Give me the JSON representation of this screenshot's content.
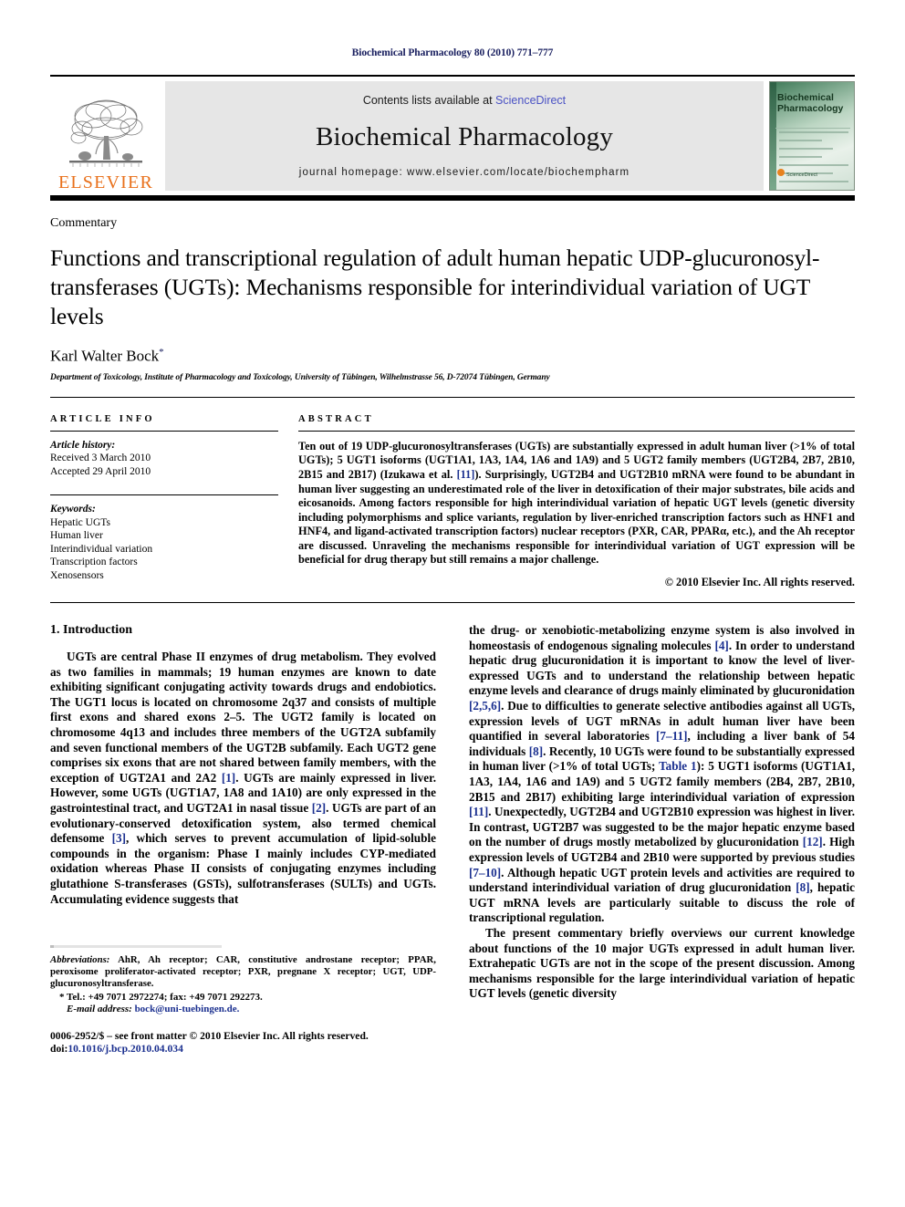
{
  "running_head": "Biochemical Pharmacology 80 (2010) 771–777",
  "masthead": {
    "publisher_word": "ELSEVIER",
    "contents_prefix": "Contents lists available at ",
    "contents_link": "ScienceDirect",
    "journal_name": "Biochemical Pharmacology",
    "homepage": "journal homepage: www.elsevier.com/locate/biochempharm",
    "cover_title_line1": "Biochemical",
    "cover_title_line2": "Pharmacology",
    "cover_footer": "ScienceDirect"
  },
  "article": {
    "type": "Commentary",
    "title": "Functions and transcriptional regulation of adult human hepatic UDP-glucuronosyl-transferases (UGTs): Mechanisms responsible for interindividual variation of UGT levels",
    "author": "Karl Walter Bock",
    "author_marker": "*",
    "affiliation": "Department of Toxicology, Institute of Pharmacology and Toxicology, University of Tübingen, Wilhelmstrasse 56, D-72074 Tübingen, Germany"
  },
  "info": {
    "heading": "ARTICLE INFO",
    "history_label": "Article history:",
    "history": [
      "Received 3 March 2010",
      "Accepted 29 April 2010"
    ],
    "keywords_label": "Keywords:",
    "keywords": [
      "Hepatic UGTs",
      "Human liver",
      "Interindividual variation",
      "Transcription factors",
      "Xenosensors"
    ]
  },
  "abstract": {
    "heading": "ABSTRACT",
    "part1": "Ten out of 19 UDP-glucuronosyltransferases (UGTs) are substantially expressed in adult human liver (>1% of total UGTs); 5 UGT1 isoforms (UGT1A1, 1A3, 1A4, 1A6 and 1A9) and 5 UGT2 family members (UGT2B4, 2B7, 2B10, 2B15 and 2B17) (Izukawa et al. ",
    "ref1": "[11]",
    "part2": "). Surprisingly, UGT2B4 and UGT2B10 mRNA were found to be abundant in human liver suggesting an underestimated role of the liver in detoxification of their major substrates, bile acids and eicosanoids. Among factors responsible for high interindividual variation of hepatic UGT levels (genetic diversity including polymorphisms and splice variants, regulation by liver-enriched transcription factors such as HNF1 and HNF4, and ligand-activated transcription factors) nuclear receptors (PXR, CAR, PPARα, etc.), and the Ah receptor are discussed. Unraveling the mechanisms responsible for interindividual variation of UGT expression will be beneficial for drug therapy but still remains a major challenge.",
    "copyright": "© 2010 Elsevier Inc. All rights reserved."
  },
  "body": {
    "section_title": "1. Introduction",
    "left_p1_a": "UGTs are central Phase II enzymes of drug metabolism. They evolved as two families in mammals; 19 human enzymes are known to date exhibiting significant conjugating activity towards drugs and endobiotics. The UGT1 locus is located on chromosome 2q37 and consists of multiple first exons and shared exons 2–5. The UGT2 family is located on chromosome 4q13 and includes three members of the UGT2A subfamily and seven functional members of the UGT2B subfamily. Each UGT2 gene comprises six exons that are not shared between family members, with the exception of UGT2A1 and 2A2 ",
    "left_ref1": "[1]",
    "left_p1_b": ". UGTs are mainly expressed in liver. However, some UGTs (UGT1A7, 1A8 and 1A10) are only expressed in the gastrointestinal tract, and UGT2A1 in nasal tissue ",
    "left_ref2": "[2]",
    "left_p1_c": ". UGTs are part of an evolutionary-conserved detoxification system, also termed chemical defensome ",
    "left_ref3": "[3]",
    "left_p1_d": ", which serves to prevent accumulation of lipid-soluble compounds in the organism: Phase I mainly includes CYP-mediated oxidation whereas Phase II consists of conjugating enzymes including glutathione S-transferases (GSTs), sulfotransferases (SULTs) and UGTs. Accumulating evidence suggests that",
    "right_p1_a": "the drug- or xenobiotic-metabolizing enzyme system is also involved in homeostasis of endogenous signaling molecules ",
    "right_ref1": "[4]",
    "right_p1_b": ". In order to understand hepatic drug glucuronidation it is important to know the level of liver-expressed UGTs and to understand the relationship between hepatic enzyme levels and clearance of drugs mainly eliminated by glucuronidation ",
    "right_ref2": "[2,5,6]",
    "right_p1_c": ". Due to difficulties to generate selective antibodies against all UGTs, expression levels of UGT mRNAs in adult human liver have been quantified in several laboratories ",
    "right_ref3": "[7–11]",
    "right_p1_d": ", including a liver bank of 54 individuals ",
    "right_ref4": "[8]",
    "right_p1_e": ". Recently, 10 UGTs were found to be substantially expressed in human liver (>1% of total UGTs; ",
    "right_ref5": "Table 1",
    "right_p1_f": "): 5 UGT1 isoforms (UGT1A1, 1A3, 1A4, 1A6 and 1A9) and 5 UGT2 family members (2B4, 2B7, 2B10, 2B15 and 2B17) exhibiting large interindividual variation of expression ",
    "right_ref6": "[11]",
    "right_p1_g": ". Unexpectedly, UGT2B4 and UGT2B10 expression was highest in liver. In contrast, UGT2B7 was suggested to be the major hepatic enzyme based on the number of drugs mostly metabolized by glucuronidation ",
    "right_ref7": "[12]",
    "right_p1_h": ". High expression levels of UGT2B4 and 2B10 were supported by previous studies ",
    "right_ref8": "[7–10]",
    "right_p1_i": ". Although hepatic UGT protein levels and activities are required to understand interindividual variation of drug glucuronidation ",
    "right_ref9": "[8]",
    "right_p1_j": ", hepatic UGT mRNA levels are particularly suitable to discuss the role of transcriptional regulation.",
    "right_p2": "The present commentary briefly overviews our current knowledge about functions of the 10 major UGTs expressed in adult human liver. Extrahepatic UGTs are not in the scope of the present discussion. Among mechanisms responsible for the large interindividual variation of hepatic UGT levels (genetic diversity"
  },
  "footnotes": {
    "abbrev_label": "Abbreviations:",
    "abbrev_text": " AhR, Ah receptor; CAR, constitutive androstane receptor; PPAR, peroxisome proliferator-activated receptor; PXR, pregnane X receptor; UGT, UDP-glucuronosyltransferase.",
    "tel": "* Tel.: +49 7071 2972274; fax: +49 7071 292273.",
    "email_label": "E-mail address:",
    "email": " bock@uni-tuebingen.de.",
    "imprint_line1_a": "0006-2952/$ – see front matter © 2010 Elsevier Inc. All rights reserved.",
    "imprint_line2_label": "doi:",
    "imprint_line2_doi": "10.1016/j.bcp.2010.04.034"
  },
  "colors": {
    "running_head": "#1a2060",
    "link": "#4a52c4",
    "reference": "#1a2f8f",
    "elsevier_orange": "#E9711C",
    "band_gray": "#e6e6e6"
  }
}
